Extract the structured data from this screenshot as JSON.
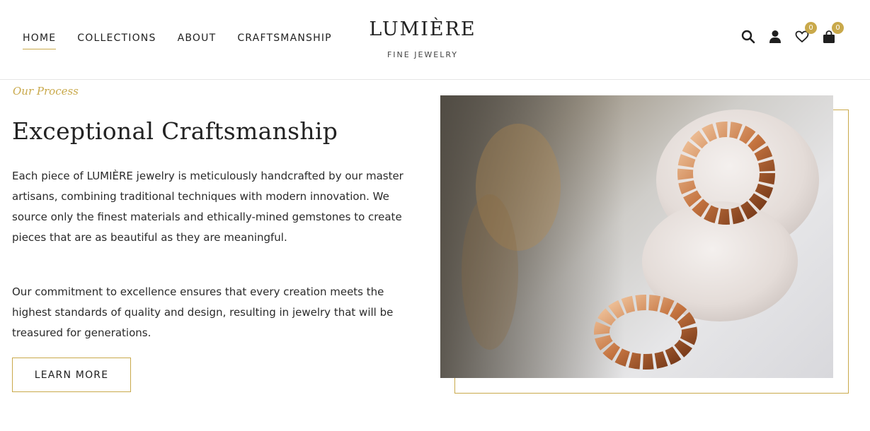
{
  "nav": {
    "items": [
      {
        "label": "HOME",
        "active": true
      },
      {
        "label": "COLLECTIONS",
        "active": false
      },
      {
        "label": "ABOUT",
        "active": false
      },
      {
        "label": "CRAFTSMANSHIP",
        "active": false
      }
    ]
  },
  "brand": {
    "name": "LUMIÈRE",
    "tagline": "FINE JEWELRY"
  },
  "header_icons": {
    "search": "search-icon",
    "account": "user-icon",
    "wishlist": "heart-icon",
    "cart": "bag-icon",
    "wishlist_count": "0",
    "cart_count": "0"
  },
  "section": {
    "eyebrow": "Our Process",
    "title": "Exceptional Craftsmanship",
    "paragraph1": "Each piece of LUMIÈRE jewelry is meticulously handcrafted by our master artisans, combining traditional techniques with modern innovation. We source only the finest materials and ethically-mined gemstones to create pieces that are as beautiful as they are meaningful.",
    "paragraph2": "Our commitment to excellence ensures that every creation meets the highest standards of quality and design, resulting in jewelry that will be treasured for generations.",
    "button_label": "LEARN MORE"
  },
  "colors": {
    "accent_gold": "#c9a94b",
    "text_dark": "#1f1f1f",
    "border_light": "#e6e6e6"
  }
}
